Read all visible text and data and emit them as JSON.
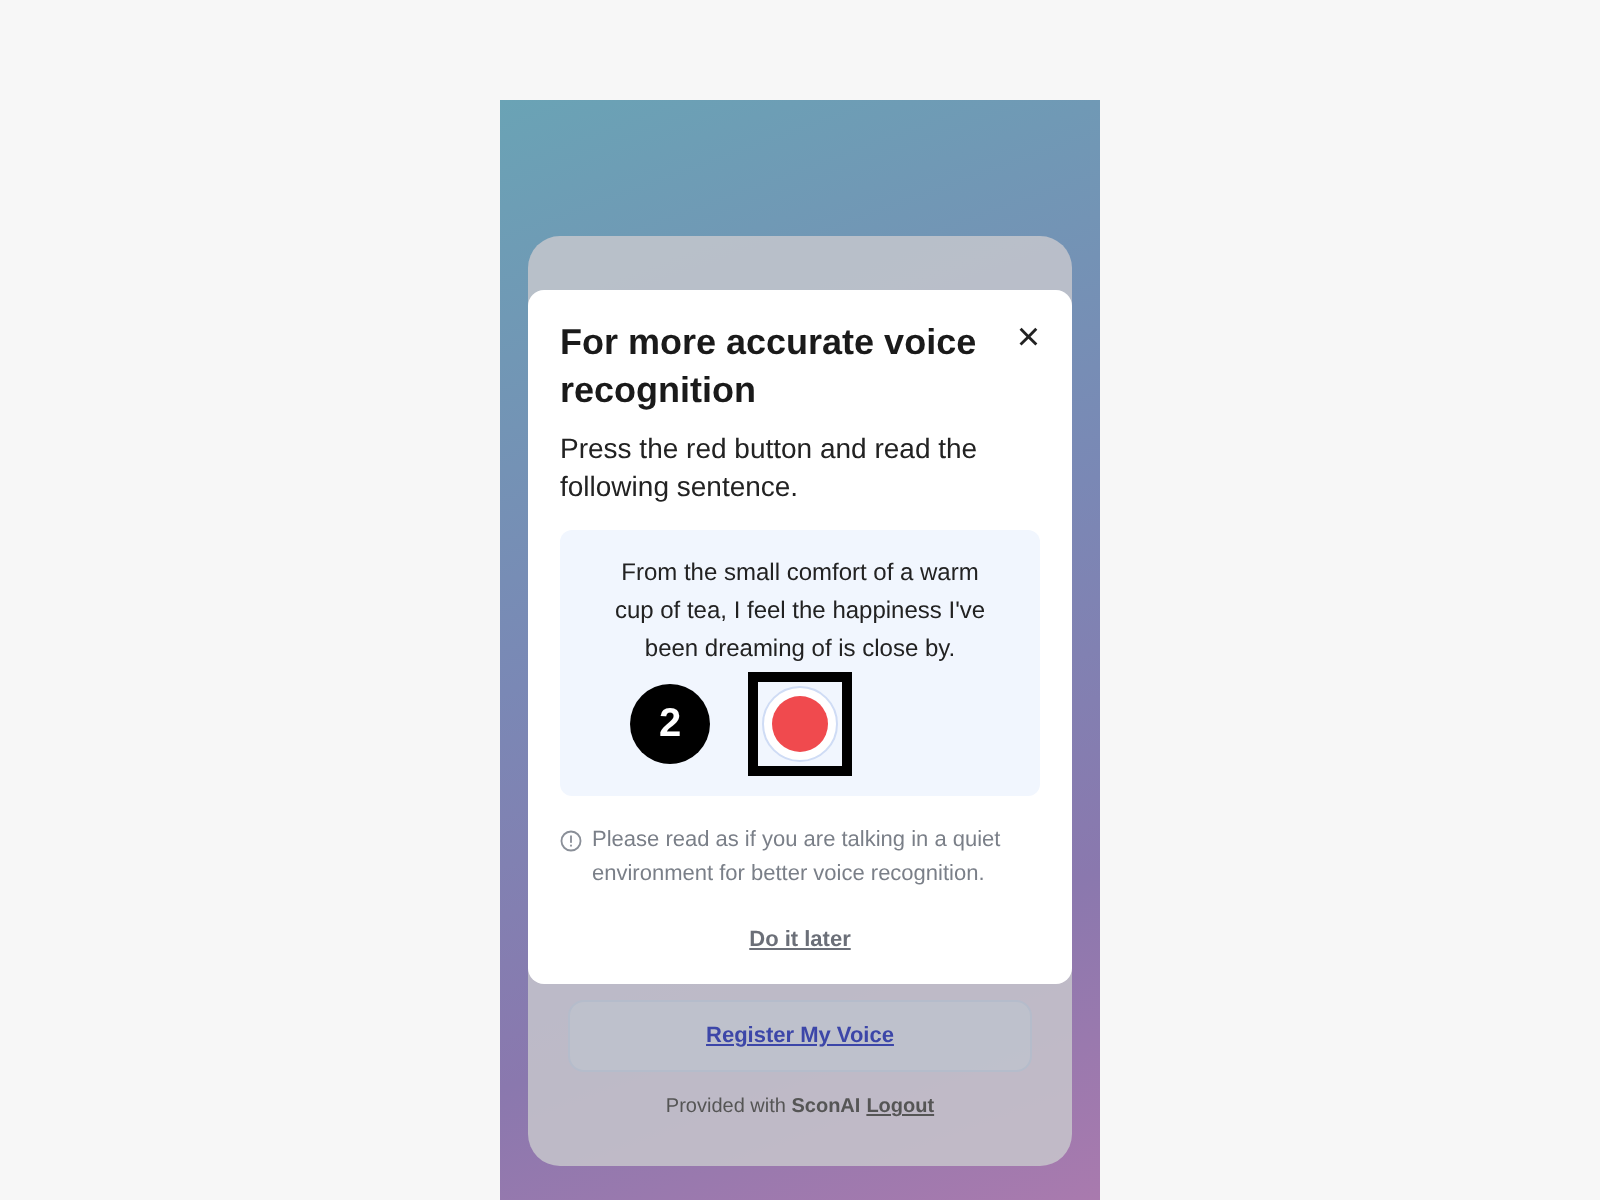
{
  "background_card": {
    "register_button": "Register My Voice",
    "footer": {
      "text": "Provided with ",
      "brand": "SconAI",
      "logout": "Logout"
    }
  },
  "dialog": {
    "title": "For more accurate voice recognition",
    "close": "×",
    "instruction": "Press the red button and read the following sentence.",
    "sentence": "From the small comfort of a warm cup of tea, I feel the happiness I've been dreaming of is close by.",
    "note": "Please read as if you are talking in a quiet environment for better voice recognition.",
    "later": "Do it later"
  },
  "annotation": {
    "step": "2"
  }
}
